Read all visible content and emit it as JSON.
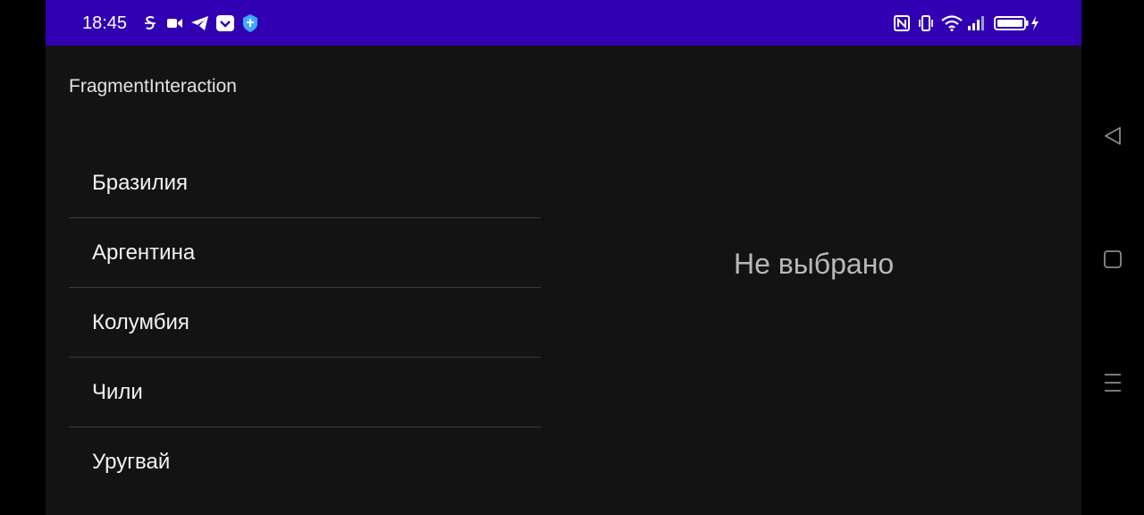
{
  "status_bar": {
    "time": "18:45",
    "left_icons": [
      "s-app-icon",
      "video-camera-icon",
      "telegram-icon",
      "pocket-icon",
      "shield-icon"
    ],
    "right_icons": [
      "nfc-icon",
      "vibrate-icon",
      "wifi-icon",
      "cellular-signal-icon",
      "battery-charging-icon"
    ],
    "background_color": "#3100b3"
  },
  "app": {
    "title": "FragmentInteraction"
  },
  "country_list": {
    "items": [
      {
        "label": "Бразилия"
      },
      {
        "label": "Аргентина"
      },
      {
        "label": "Колумбия"
      },
      {
        "label": "Чили"
      },
      {
        "label": "Уругвай"
      }
    ]
  },
  "detail": {
    "text": "Не выбрано"
  },
  "navigation_bar": {
    "buttons": [
      "back-icon",
      "home-icon",
      "menu-icon"
    ]
  }
}
